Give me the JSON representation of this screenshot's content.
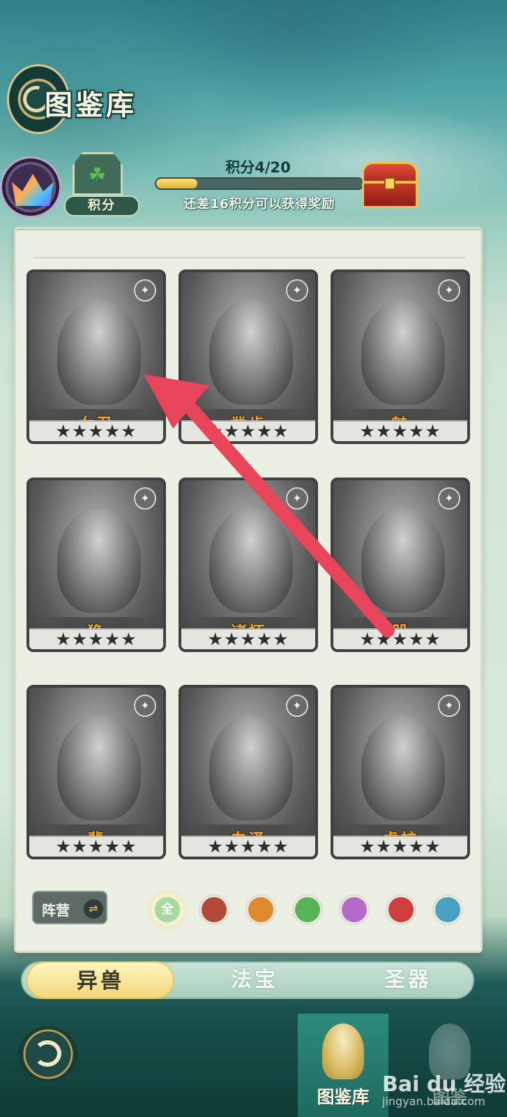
{
  "header": {
    "title": "图鉴库"
  },
  "score": {
    "badge_label": "积分",
    "progress_text": "积分4/20",
    "progress_fraction": 0.2,
    "hint": "还差16积分可以获得奖励"
  },
  "cards": [
    {
      "name": "女丑",
      "faction_icon": "wind-icon",
      "stars": "★★★★★"
    },
    {
      "name": "凿齿",
      "faction_icon": "temple-icon",
      "stars": "★★★★★"
    },
    {
      "name": "魅",
      "faction_icon": "demon-icon",
      "stars": "★★★★★"
    },
    {
      "name": "狰",
      "faction_icon": "paw-icon",
      "stars": "★★★★★"
    },
    {
      "name": "诸怀",
      "faction_icon": "temple-icon",
      "stars": "★★★★★"
    },
    {
      "name": "兕",
      "faction_icon": "demon-icon",
      "stars": "★★★★★"
    },
    {
      "name": "蜚",
      "faction_icon": "demon-icon",
      "stars": "★★★★★"
    },
    {
      "name": "白泽",
      "faction_icon": "wind-icon",
      "stars": "★★★★★"
    },
    {
      "name": "虎蛟",
      "faction_icon": "paw-icon",
      "stars": "★★★★★"
    }
  ],
  "faction_filter": {
    "label": "阵营",
    "swap_glyph": "⇌",
    "options": [
      {
        "label": "全",
        "color": "#a9d9a0",
        "active": true
      },
      {
        "label": "",
        "color": "#b34a38"
      },
      {
        "label": "",
        "color": "#e08a2e"
      },
      {
        "label": "",
        "color": "#57b357"
      },
      {
        "label": "",
        "color": "#b36ac9"
      },
      {
        "label": "",
        "color": "#cf3d3d"
      },
      {
        "label": "",
        "color": "#4aa0c0"
      }
    ]
  },
  "tabs": [
    {
      "label": "异兽",
      "active": true
    },
    {
      "label": "法宝"
    },
    {
      "label": "圣器"
    }
  ],
  "bottom_nav": {
    "items": [
      {
        "label": "图鉴库",
        "active": true
      },
      {
        "label": "图鉴"
      }
    ]
  },
  "watermark": {
    "brand": "Bai du 经验",
    "url": "jingyan.baidu.com"
  }
}
